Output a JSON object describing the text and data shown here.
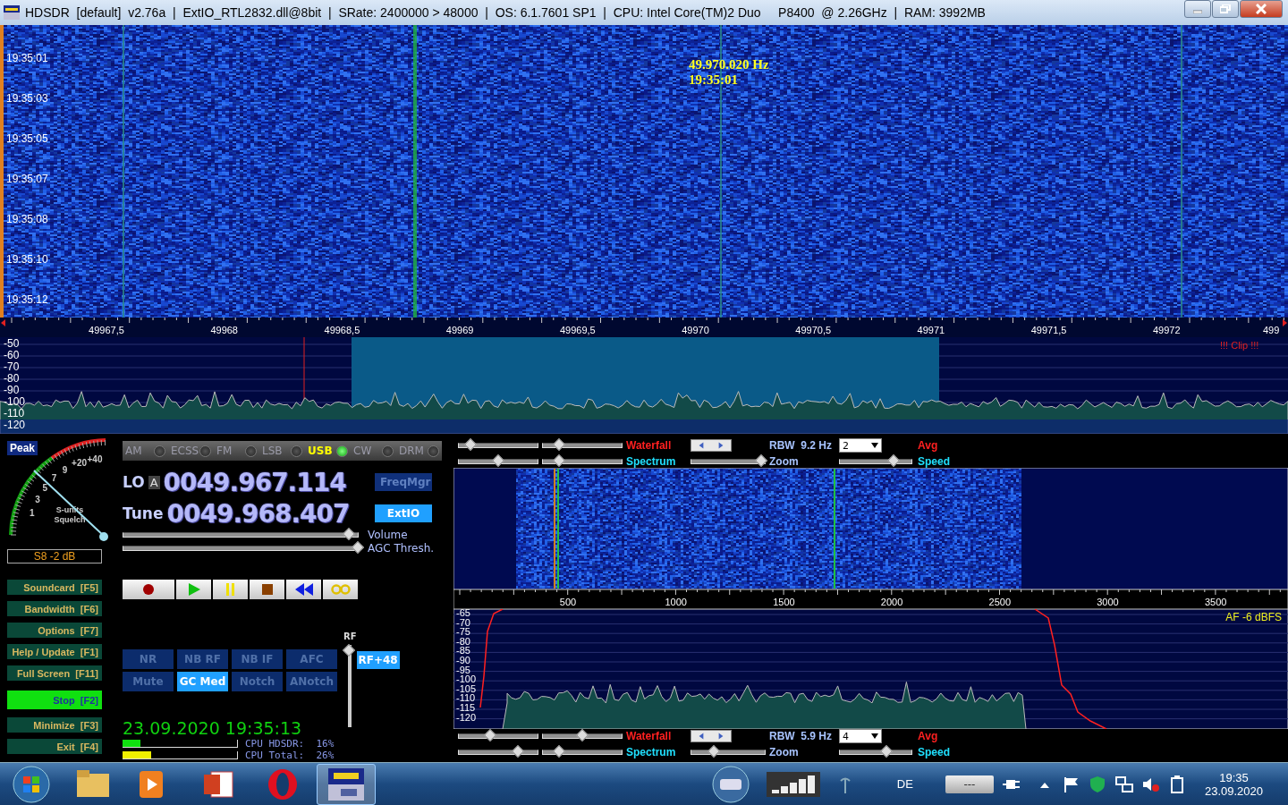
{
  "window": {
    "title": "HDSDR  [default]  v2.76a  |  ExtIO_RTL2832.dll@8bit  |  SRate: 2400000 > 48000  |  OS: 6.1.7601 SP1  |  CPU: Intel Core(TM)2 Duo     P8400  @ 2.26GHz  |  RAM: 3992MB"
  },
  "waterfall": {
    "time_labels": [
      "19:35:01",
      "19:35:03",
      "19:35:05",
      "19:35:07",
      "19:35:08",
      "19:35:10",
      "19:35:12"
    ],
    "cursor_readout": [
      "49.970.020 Hz",
      "19:35:01"
    ]
  },
  "freq_axis": {
    "labels": [
      "49967,5",
      "49968",
      "49968,5",
      "49969",
      "49969,5",
      "49970",
      "49970,5",
      "49971",
      "49971,5",
      "49972",
      "499"
    ]
  },
  "spectrum": {
    "db_labels": [
      "-50",
      "-60",
      "-70",
      "-80",
      "-90",
      "-100",
      "-110",
      "-120"
    ],
    "clip_warning": "!!! Clip !!!"
  },
  "smeter": {
    "badge": "Peak",
    "scale_labels": [
      "+40",
      "+20",
      "9",
      "7",
      "5",
      "3",
      "1"
    ],
    "captions": [
      "S-units",
      "Squelch"
    ],
    "reading": "S8 -2 dB"
  },
  "side_buttons": [
    {
      "label": "Soundcard",
      "key": "[F5]",
      "on": false
    },
    {
      "label": "Bandwidth",
      "key": "[F6]",
      "on": false
    },
    {
      "label": "Options",
      "key": "[F7]",
      "on": false
    },
    {
      "label": "Help / Update",
      "key": "[F1]",
      "on": false
    },
    {
      "label": "Full Screen",
      "key": "[F11]",
      "on": false
    },
    {
      "label": "Stop",
      "key": "[F2]",
      "on": true
    },
    {
      "label": "Minimize",
      "key": "[F3]",
      "on": false
    },
    {
      "label": "Exit",
      "key": "[F4]",
      "on": false
    }
  ],
  "modes": [
    {
      "label": "AM",
      "selected": false
    },
    {
      "label": "ECSS",
      "selected": false
    },
    {
      "label": "FM",
      "selected": false
    },
    {
      "label": "LSB",
      "selected": false
    },
    {
      "label": "USB",
      "selected": true
    },
    {
      "label": "CW",
      "selected": false
    },
    {
      "label": "DRM",
      "selected": false
    }
  ],
  "lo": {
    "label": "LO",
    "bank": "A",
    "freq": "0049.967.114"
  },
  "tune": {
    "label": "Tune",
    "freq": "0049.968.407"
  },
  "freqmgr": {
    "label": "FreqMgr",
    "on": false
  },
  "extio": {
    "label": "ExtIO",
    "on": true
  },
  "sliders": [
    {
      "label": "Volume",
      "level": 0.96
    },
    {
      "label": "AGC Thresh.",
      "level": 1.0
    }
  ],
  "dsp_buttons": [
    {
      "label": "NR",
      "on": false
    },
    {
      "label": "NB RF",
      "on": false
    },
    {
      "label": "NB IF",
      "on": false
    },
    {
      "label": "AFC",
      "on": false
    },
    {
      "label": "Mute",
      "on": false
    },
    {
      "label": "GC Med",
      "on": true
    },
    {
      "label": "Notch",
      "on": false
    },
    {
      "label": "ANotch",
      "on": false
    }
  ],
  "rf": {
    "label": "RF",
    "level": 1.0,
    "gain": "RF+48"
  },
  "clock": "23.09.2020 19:35:13",
  "cpu": [
    {
      "label": "CPU HDSDR:  16%",
      "level": 0.16
    },
    {
      "label": "CPU Total:  26%",
      "level": 0.25
    }
  ],
  "audio_waterfall_controls": {
    "sliders": [
      {
        "level": 0.15
      },
      {
        "level": 0.2
      },
      {
        "level": 0.5
      },
      {
        "level": 0.2
      }
    ],
    "waterfall_label": "Waterfall",
    "rbw": "RBW  9.2 Hz",
    "avg_value": "2",
    "avg_label": "Avg",
    "spectrum_label": "Spectrum",
    "zoom": {
      "label": "Zoom",
      "level": 0.95
    },
    "speed": {
      "label": "Speed",
      "level": 0.75
    }
  },
  "audio_axis": {
    "labels": [
      "500",
      "1000",
      "1500",
      "2000",
      "2500",
      "3000",
      "3500"
    ]
  },
  "audio_spectrum": {
    "db_labels": [
      "-65",
      "-70",
      "-75",
      "-80",
      "-85",
      "-90",
      "-95",
      "-100",
      "-105",
      "-110",
      "-115",
      "-120"
    ],
    "af_level": "AF  -6 dBFS"
  },
  "audio_spectrum_controls": {
    "sliders": [
      {
        "level": 0.4
      },
      {
        "level": 0.5
      },
      {
        "level": 0.75
      },
      {
        "level": 0.2
      }
    ],
    "waterfall_label": "Waterfall",
    "rbw": "RBW  5.9 Hz",
    "avg_value": "4",
    "avg_label": "Avg",
    "spectrum_label": "Spectrum",
    "zoom": {
      "label": "Zoom",
      "level": 0.3
    },
    "speed": {
      "label": "Speed",
      "level": 0.65
    }
  },
  "taskbar": {
    "language": "DE",
    "battery_meter": "---",
    "time": "19:35",
    "date": "23.09.2020"
  }
}
